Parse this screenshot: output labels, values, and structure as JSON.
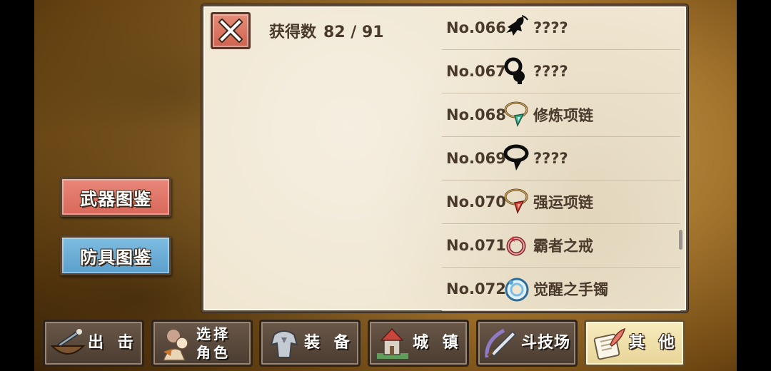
{
  "side_tabs": {
    "weapon_label": "武器图鉴",
    "armor_label": "防具图鉴"
  },
  "header": {
    "count_label": "获得数",
    "count_value": "82 / 91"
  },
  "items": [
    {
      "no": "No.066",
      "name": "????",
      "icon": "silhouette-feather-icon"
    },
    {
      "no": "No.067",
      "name": "????",
      "icon": "silhouette-pendant-icon"
    },
    {
      "no": "No.068",
      "name": "修炼项链",
      "icon": "green-gem-necklace-icon"
    },
    {
      "no": "No.069",
      "name": "????",
      "icon": "silhouette-necklace-icon"
    },
    {
      "no": "No.070",
      "name": "强运项链",
      "icon": "red-gem-necklace-icon"
    },
    {
      "no": "No.071",
      "name": "霸者之戒",
      "icon": "red-ring-icon"
    },
    {
      "no": "No.072",
      "name": "觉醒之手镯",
      "icon": "blue-bracelet-icon"
    }
  ],
  "nav": [
    {
      "label": "出 击",
      "icon": "battle-ship-icon"
    },
    {
      "label": "选择",
      "label2": "角色",
      "icon": "character-select-icon"
    },
    {
      "label": "装 备",
      "icon": "armor-equip-icon"
    },
    {
      "label": "城 镇",
      "icon": "castle-town-icon"
    },
    {
      "label": "斗技场",
      "icon": "arena-sword-icon"
    },
    {
      "label": "其 他",
      "icon": "scroll-quill-icon"
    }
  ],
  "colors": {
    "weapon_tab": "#d9685a",
    "armor_tab": "#5a9fcc",
    "close_button": "#cf6350",
    "parchment": "#f0e6d1",
    "text": "#4a3a2c"
  }
}
